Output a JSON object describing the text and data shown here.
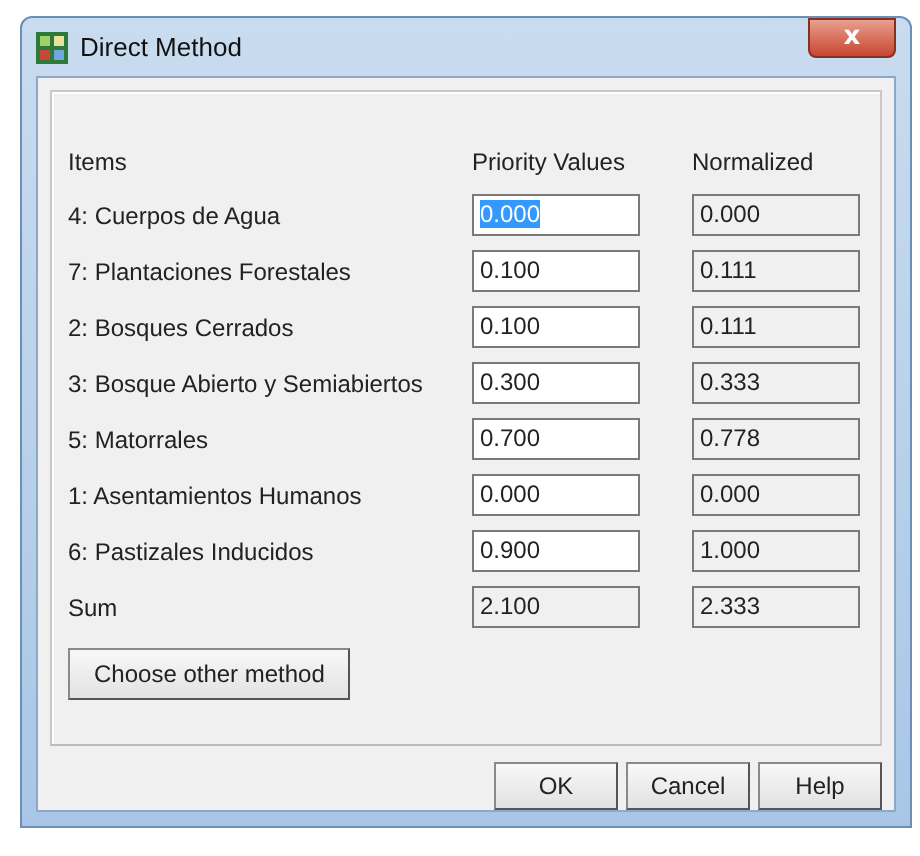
{
  "window": {
    "title": "Direct Method",
    "close_label": "x"
  },
  "table": {
    "columns": [
      "Items",
      "Priority Values",
      "Normalized"
    ],
    "rows": [
      {
        "item": "4: Cuerpos de Agua",
        "priority": "0.000",
        "normalized": "0.000",
        "selected": true
      },
      {
        "item": "7: Plantaciones Forestales",
        "priority": "0.100",
        "normalized": "0.111",
        "selected": false
      },
      {
        "item": "2: Bosques Cerrados",
        "priority": "0.100",
        "normalized": "0.111",
        "selected": false
      },
      {
        "item": "3: Bosque Abierto y Semiabiertos",
        "priority": "0.300",
        "normalized": "0.333",
        "selected": false
      },
      {
        "item": "5: Matorrales",
        "priority": "0.700",
        "normalized": "0.778",
        "selected": false
      },
      {
        "item": "1: Asentamientos Humanos",
        "priority": "0.000",
        "normalized": "0.000",
        "selected": false
      },
      {
        "item": "6: Pastizales Inducidos",
        "priority": "0.900",
        "normalized": "1.000",
        "selected": false
      }
    ],
    "sum": {
      "label": "Sum",
      "priority": "2.100",
      "normalized": "2.333"
    }
  },
  "choose_button": "Choose other method",
  "buttons": [
    "OK",
    "Cancel",
    "Help"
  ]
}
